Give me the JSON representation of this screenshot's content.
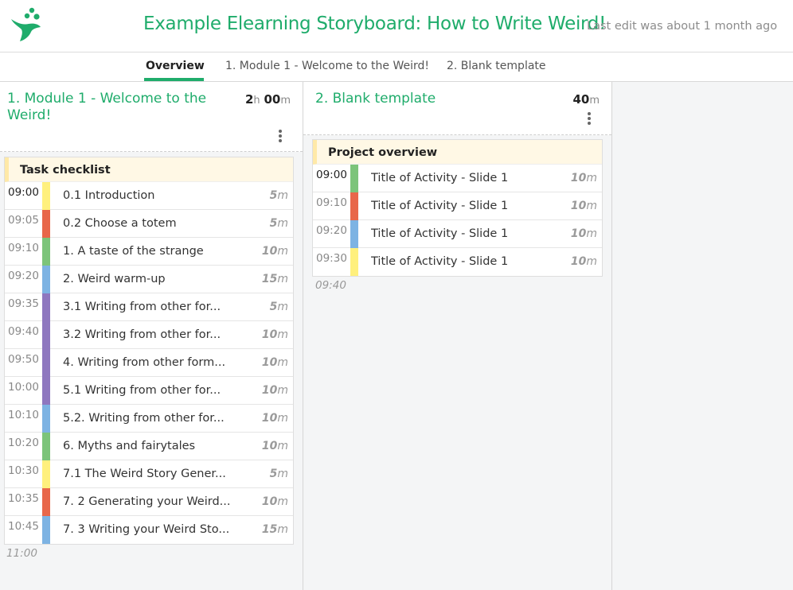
{
  "header": {
    "title": "Example Elearning Storyboard: How to Write Weird!",
    "last_edit": "Last edit was about 1 month ago"
  },
  "tabs": [
    {
      "label": "Overview",
      "active": true
    },
    {
      "label": "1. Module 1 - Welcome to the Weird!",
      "active": false
    },
    {
      "label": "2. Blank template",
      "active": false
    }
  ],
  "colors": {
    "brand_green": "#1fac6b",
    "yellow": "#fff07d",
    "red": "#e8674a",
    "green": "#7cc47a",
    "blue": "#7db3e3",
    "purple": "#8e77bf"
  },
  "modules": [
    {
      "title": "1. Module 1 - Welcome to the Weird!",
      "duration": {
        "hours": "2",
        "hours_unit": "h",
        "minutes": "00",
        "minutes_unit": "m"
      },
      "panel_title": "Task checklist",
      "end_time": "11:00",
      "rows": [
        {
          "time": "09:00",
          "label": "0.1 Introduction",
          "mins": "5",
          "unit": "m",
          "color": "#fff07d"
        },
        {
          "time": "09:05",
          "label": "0.2 Choose a totem",
          "mins": "5",
          "unit": "m",
          "color": "#e8674a"
        },
        {
          "time": "09:10",
          "label": "1. A taste of the strange",
          "mins": "10",
          "unit": "m",
          "color": "#7cc47a"
        },
        {
          "time": "09:20",
          "label": "2. Weird warm-up",
          "mins": "15",
          "unit": "m",
          "color": "#7db3e3"
        },
        {
          "time": "09:35",
          "label": "3.1 Writing from other for...",
          "mins": "5",
          "unit": "m",
          "color": "#8e77bf"
        },
        {
          "time": "09:40",
          "label": "3.2 Writing from other for...",
          "mins": "10",
          "unit": "m",
          "color": "#8e77bf"
        },
        {
          "time": "09:50",
          "label": "4. Writing from other form...",
          "mins": "10",
          "unit": "m",
          "color": "#8e77bf"
        },
        {
          "time": "10:00",
          "label": "5.1 Writing from other for...",
          "mins": "10",
          "unit": "m",
          "color": "#8e77bf"
        },
        {
          "time": "10:10",
          "label": "5.2. Writing from other for...",
          "mins": "10",
          "unit": "m",
          "color": "#7db3e3"
        },
        {
          "time": "10:20",
          "label": "6. Myths and fairytales",
          "mins": "10",
          "unit": "m",
          "color": "#7cc47a"
        },
        {
          "time": "10:30",
          "label": "7.1 The Weird Story Gener...",
          "mins": "5",
          "unit": "m",
          "color": "#fff07d"
        },
        {
          "time": "10:35",
          "label": "7. 2 Generating your Weird...",
          "mins": "10",
          "unit": "m",
          "color": "#e8674a"
        },
        {
          "time": "10:45",
          "label": "7. 3 Writing your Weird Sto...",
          "mins": "15",
          "unit": "m",
          "color": "#7db3e3"
        }
      ]
    },
    {
      "title": "2. Blank template",
      "duration": {
        "minutes": "40",
        "minutes_unit": "m"
      },
      "panel_title": "Project overview",
      "end_time": "09:40",
      "rows": [
        {
          "time": "09:00",
          "label": "Title of Activity - Slide 1",
          "mins": "10",
          "unit": "m",
          "color": "#7cc47a"
        },
        {
          "time": "09:10",
          "label": "Title of Activity - Slide 1",
          "mins": "10",
          "unit": "m",
          "color": "#e8674a"
        },
        {
          "time": "09:20",
          "label": "Title of Activity - Slide 1",
          "mins": "10",
          "unit": "m",
          "color": "#7db3e3"
        },
        {
          "time": "09:30",
          "label": "Title of Activity - Slide 1",
          "mins": "10",
          "unit": "m",
          "color": "#fff07d"
        }
      ]
    }
  ]
}
